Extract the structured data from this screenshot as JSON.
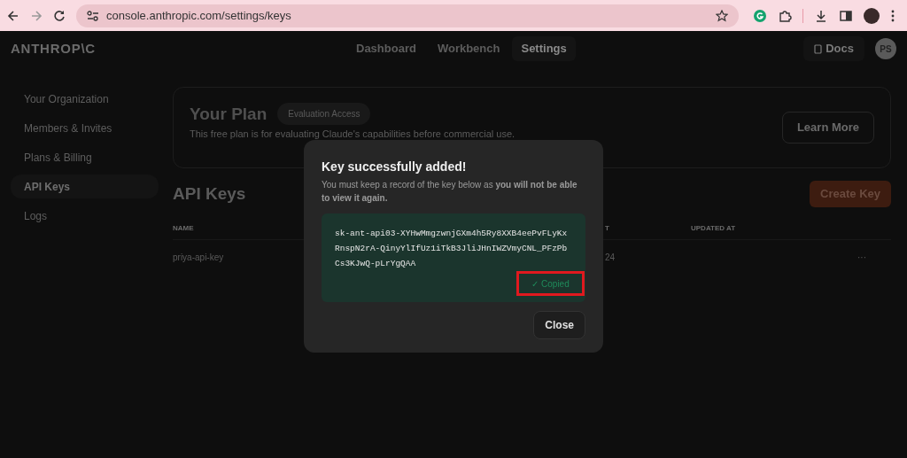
{
  "browser": {
    "url": "console.anthropic.com/settings/keys"
  },
  "header": {
    "logo": "ANTHROP\\C",
    "nav": [
      {
        "label": "Dashboard",
        "selected": false
      },
      {
        "label": "Workbench",
        "selected": false
      },
      {
        "label": "Settings",
        "selected": true
      }
    ],
    "docs": "Docs",
    "avatar": "PS"
  },
  "sidebar": {
    "items": [
      {
        "label": "Your Organization",
        "selected": false
      },
      {
        "label": "Members & Invites",
        "selected": false
      },
      {
        "label": "Plans & Billing",
        "selected": false
      },
      {
        "label": "API Keys",
        "selected": true
      },
      {
        "label": "Logs",
        "selected": false
      }
    ]
  },
  "plan": {
    "title": "Your Plan",
    "badge": "Evaluation Access",
    "description": "This free plan is for evaluating Claude's capabilities before commercial use.",
    "button": "Learn More"
  },
  "api_keys": {
    "title": "API Keys",
    "button": "Create Key",
    "columns": [
      "NAME",
      "T",
      "UPDATED AT"
    ],
    "rows": [
      {
        "name": "priya-api-key",
        "column_2": "24",
        "menu": "···"
      }
    ]
  },
  "modal": {
    "title": "Key successfully added!",
    "message": "You must keep a record of the key below as **you will not be able to view it again.**",
    "key_lines": [
      "sk-ant-api03-XYHwMmgzwnjGXm4h5Ry8XXB4eePvFLyKx",
      "RnspN2rA-QinyYlIfUz1iTkB3JliJHnIWZVmyCNL_PFzPb",
      "Cs3KJwQ-pLrYgQAA"
    ],
    "copied": "✓ Copied",
    "close": "Close"
  }
}
